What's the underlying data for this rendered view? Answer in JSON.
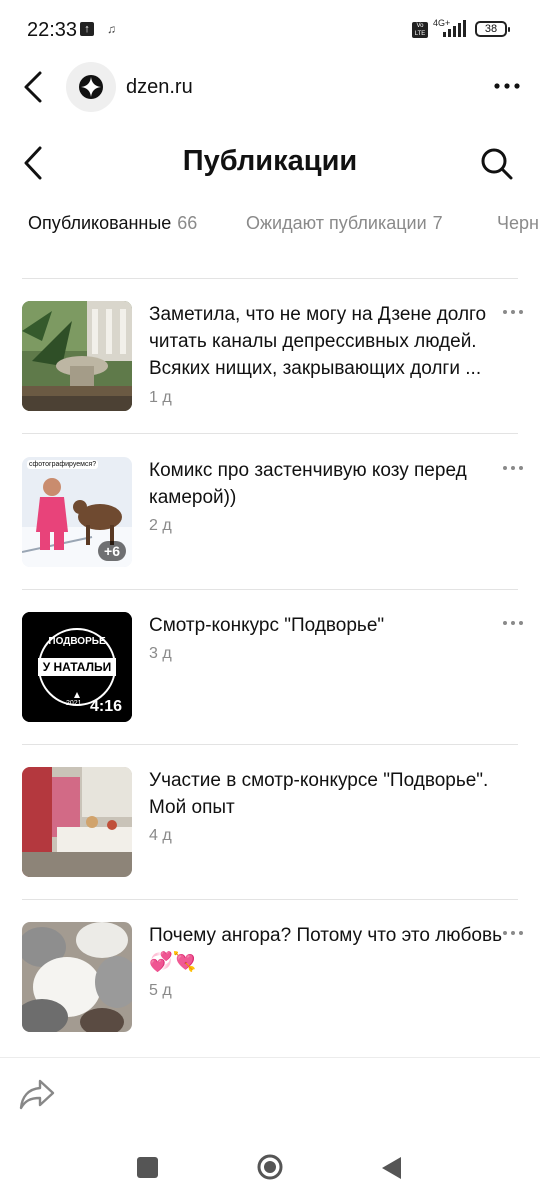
{
  "status_bar": {
    "time": "22:33",
    "network": "4G+",
    "volte": "Vo LTE",
    "battery": "38"
  },
  "browser": {
    "url": "dzen.ru"
  },
  "page": {
    "title": "Публикации"
  },
  "tabs": [
    {
      "label": "Опубликованные",
      "count": "66",
      "active": true
    },
    {
      "label": "Ожидают публикации",
      "count": "7",
      "active": false
    },
    {
      "label": "Черн",
      "count": "",
      "active": false
    }
  ],
  "publications": [
    {
      "title": "Заметила, что не могу на Дзене долго читать каналы депрессивных людей. Всяких нищих, закрывающих долги ...",
      "age": "1 д",
      "thumb": "garden-photo"
    },
    {
      "title": "Комикс про застенчивую козу перед камерой))",
      "age": "2 д",
      "thumb": "girl-goat-photo",
      "badge": "+6",
      "thumb_caption": "сфотографируемся?"
    },
    {
      "title": "Смотр-конкурс \"Подворье\"",
      "age": "3 д",
      "thumb": "video-cover",
      "duration": "4:16",
      "cover_text": [
        "ПОДВОРЬЕ",
        "У НАТАЛЬИ",
        "2021"
      ]
    },
    {
      "title": "Участие в смотр-конкурсе \"Подворье\". Мой опыт",
      "age": "4 д",
      "thumb": "fair-photo"
    },
    {
      "title": "Почему ангора? Потому что это любовь 💞💘",
      "age": "5 д",
      "thumb": "yarn-photo"
    }
  ],
  "colors": {
    "text": "#111111",
    "muted": "#8a8a8a",
    "divider": "#e3e3e3"
  }
}
